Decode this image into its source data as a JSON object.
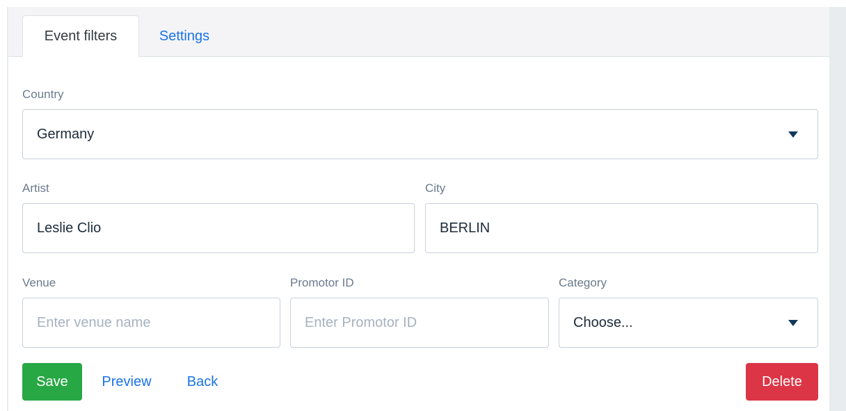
{
  "tabs": [
    {
      "label": "Event filters",
      "active": true
    },
    {
      "label": "Settings",
      "active": false
    }
  ],
  "country": {
    "label": "Country",
    "value": "Germany"
  },
  "artist": {
    "label": "Artist",
    "value": "Leslie Clio"
  },
  "city": {
    "label": "City",
    "value": "BERLIN"
  },
  "venue": {
    "label": "Venue",
    "value": "",
    "placeholder": "Enter venue name"
  },
  "promotor": {
    "label": "Promotor ID",
    "value": "",
    "placeholder": "Enter Promotor ID"
  },
  "category": {
    "label": "Category",
    "value": "Choose..."
  },
  "actions": {
    "save": "Save",
    "preview": "Preview",
    "back": "Back",
    "delete": "Delete"
  },
  "colors": {
    "link": "#1a73e8",
    "save": "#28a745",
    "delete": "#dc3545",
    "caret": "#12395c"
  },
  "icons": {
    "country_dropdown": "caret-down-icon",
    "category_dropdown": "caret-down-icon"
  }
}
